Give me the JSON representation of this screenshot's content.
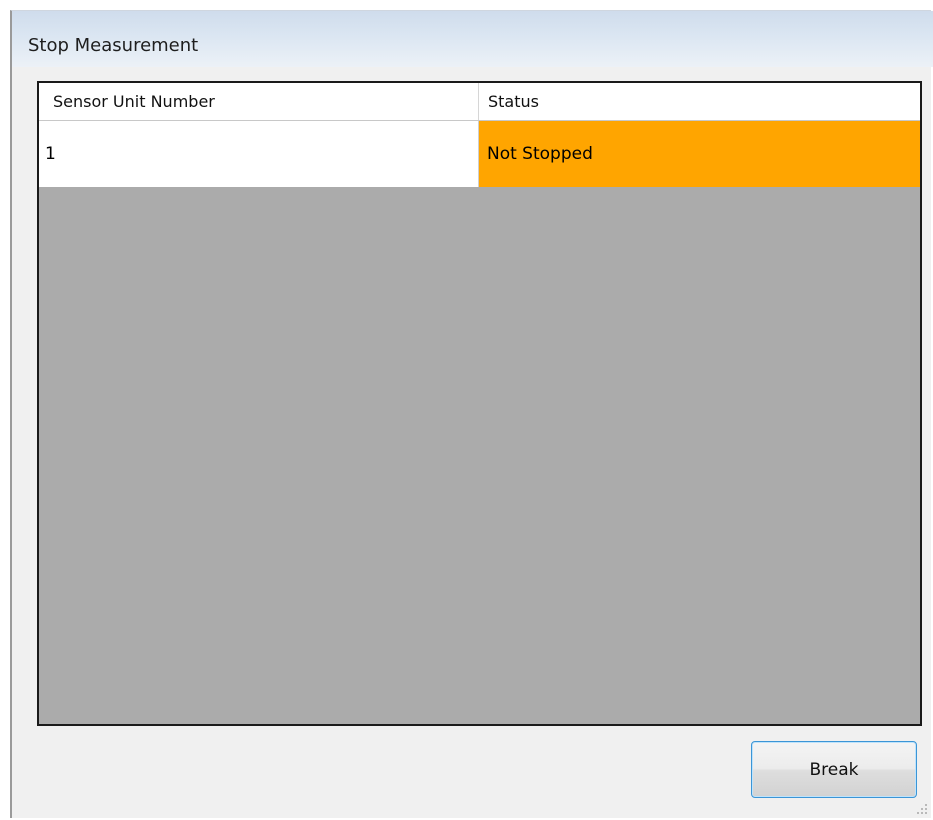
{
  "window": {
    "title": "Stop Measurement"
  },
  "table": {
    "columns": [
      "Sensor Unit Number",
      "Status"
    ],
    "rows": [
      {
        "sensor_unit_number": "1",
        "status": "Not Stopped",
        "status_color": "#ffa500"
      }
    ],
    "empty_area_color": "#ababab"
  },
  "actions": {
    "break_label": "Break"
  },
  "colors": {
    "accent": "#3b95d6",
    "title_bar": "#dbe6f2",
    "window_bg": "#f0f0f0"
  }
}
